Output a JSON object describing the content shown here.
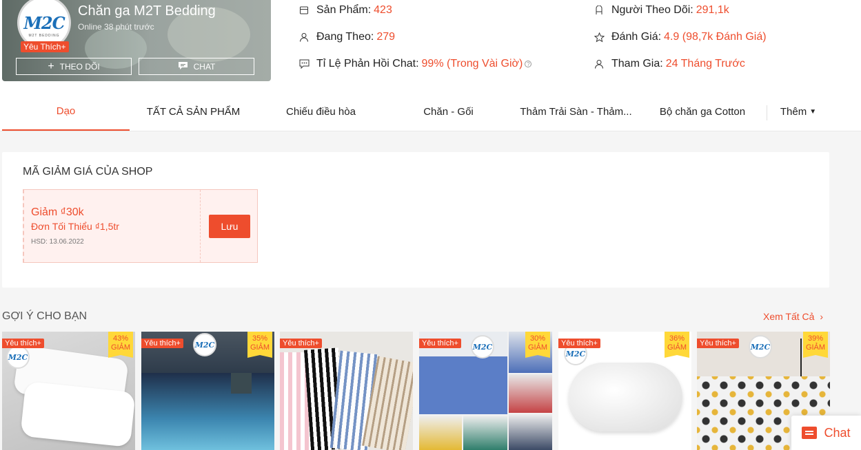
{
  "shop": {
    "name": "Chăn ga M2T Bedding",
    "online": "Online 38 phút trước",
    "fav_badge": "Yêu Thích+",
    "logo_text": "M2C",
    "logo_sub": "M2T BEDDING",
    "follow_label": "THEO DÕI",
    "chat_label": "CHAT"
  },
  "stats": {
    "products": {
      "label": "Sản Phẩm:",
      "value": "423",
      "icon": "store-icon"
    },
    "followers": {
      "label": "Người Theo Dõi:",
      "value": "291,1k",
      "icon": "followers-icon"
    },
    "following": {
      "label": "Đang Theo:",
      "value": "279",
      "icon": "user-icon"
    },
    "rating": {
      "label": "Đánh Giá:",
      "value": "4.9 (98,7k Đánh Giá)",
      "icon": "star-icon"
    },
    "response": {
      "label": "Tỉ Lệ Phản Hồi Chat:",
      "value": "99% (Trong Vài Giờ)",
      "icon": "chat-bubble-icon"
    },
    "joined": {
      "label": "Tham Gia:",
      "value": "24 Tháng Trước",
      "icon": "user-join-icon"
    }
  },
  "nav": {
    "tabs": [
      "Dạo",
      "TẤT CẢ SẢN PHẨM",
      "Chiếu điều hòa",
      "Chăn - Gối",
      "Thảm Trải Sàn - Thảm...",
      "Bộ chăn ga Cotton"
    ],
    "more": "Thêm"
  },
  "vouchers": {
    "title": "MÃ GIẢM GIÁ CỦA SHOP",
    "items": [
      {
        "discount": "Giảm ₫30k",
        "min": "Đơn Tối Thiểu ₫1,5tr",
        "expiry": "HSD: 13.06.2022",
        "button": "Lưu"
      }
    ]
  },
  "suggestions": {
    "title": "GỢI Ý CHO BẠN",
    "see_all": "Xem Tất Cả",
    "products": [
      {
        "fav": "Yêu thích+",
        "discount": "43%",
        "discount_label": "GIẢM"
      },
      {
        "fav": "Yêu thích+",
        "discount": "35%",
        "discount_label": "GIẢM"
      },
      {
        "fav": "Yêu thích+",
        "discount": "",
        "discount_label": ""
      },
      {
        "fav": "Yêu thích+",
        "discount": "30%",
        "discount_label": "GIẢM"
      },
      {
        "fav": "Yêu thích+",
        "discount": "36%",
        "discount_label": "GIẢM"
      },
      {
        "fav": "Yêu thích+",
        "discount": "39%",
        "discount_label": "GIẢM"
      }
    ]
  },
  "chat_float": {
    "label": "Chat"
  },
  "colors": {
    "accent": "#ee4d2d",
    "badge_yellow": "#ffd839"
  }
}
